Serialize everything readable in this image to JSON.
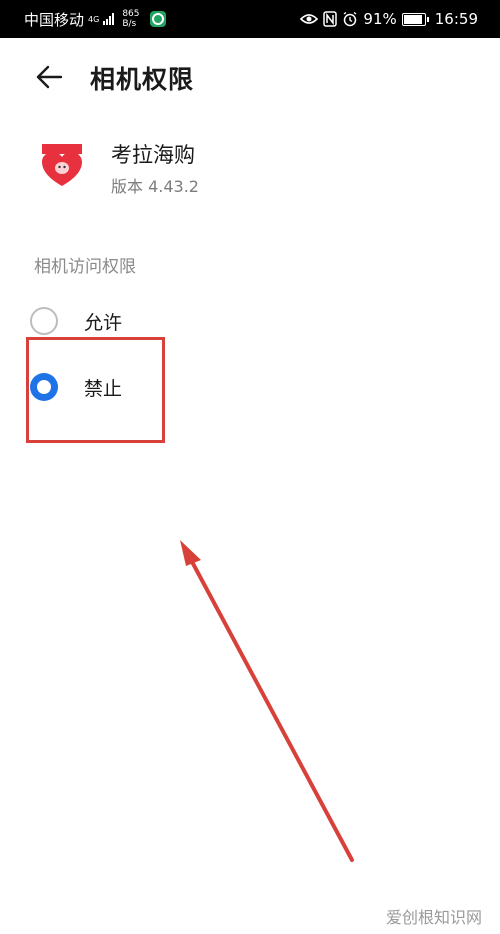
{
  "status_bar": {
    "carrier": "中国移动",
    "network_type": "4G",
    "speed_value": "865",
    "speed_unit": "B/s",
    "battery": "91%",
    "time": "16:59"
  },
  "header": {
    "title": "相机权限"
  },
  "app": {
    "name": "考拉海购",
    "version": "版本 4.43.2"
  },
  "section_title": "相机访问权限",
  "options": [
    {
      "label": "允许",
      "selected": false
    },
    {
      "label": "禁止",
      "selected": true
    }
  ],
  "watermark": "爱创根知识网",
  "colors": {
    "accent": "#1e73e6",
    "annotation": "#d8403a"
  }
}
